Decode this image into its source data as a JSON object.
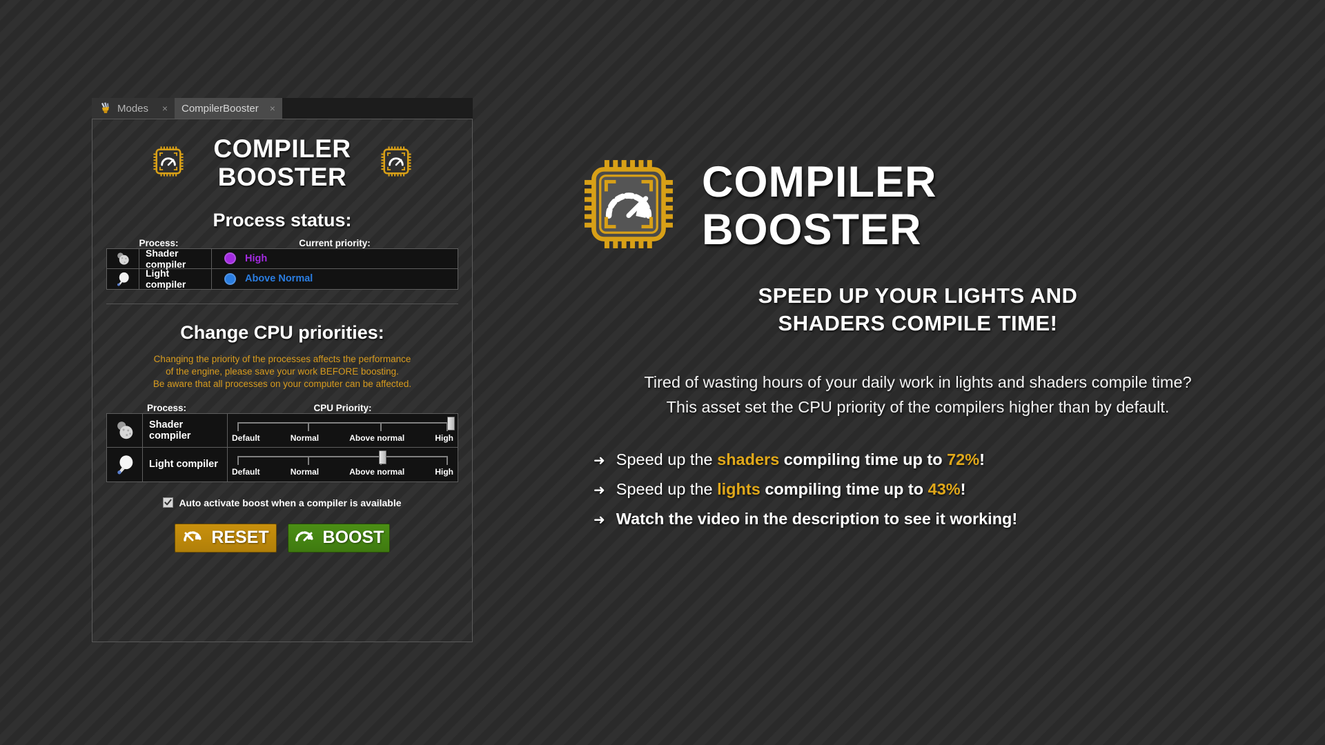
{
  "window": {
    "tabs": [
      {
        "label": "Modes",
        "icon": "modes-brush-icon",
        "active": false,
        "close": "×"
      },
      {
        "label": "CompilerBooster",
        "icon": "",
        "active": true,
        "close": "×"
      }
    ]
  },
  "panel": {
    "title_line1": "COMPILER",
    "title_line2": "BOOSTER",
    "chip_icon": "cpu-chip-gauge-icon",
    "process_status": {
      "title": "Process status:",
      "headers": {
        "process": "Process:",
        "priority": "Current priority:"
      },
      "rows": [
        {
          "icon": "shader-spheres-icon",
          "name": "Shader compiler",
          "priority": "High",
          "color": "#a22ae0"
        },
        {
          "icon": "light-bulb-icon",
          "name": "Light compiler",
          "priority": "Above Normal",
          "color": "#2a7de1"
        }
      ]
    },
    "change_priorities": {
      "title": "Change  CPU priorities:",
      "warning_lines": [
        "Changing the priority of the processes affects the performance",
        "of the engine, please save your work BEFORE boosting.",
        "Be aware that all processes on your computer can be affected."
      ],
      "warning_color": "#d79b1e",
      "headers": {
        "process": "Process:",
        "cpu": "CPU Priority:"
      },
      "slider_labels": [
        "Default",
        "Normal",
        "Above normal",
        "High"
      ],
      "rows": [
        {
          "icon": "shader-spheres-icon",
          "name": "Shader compiler",
          "value": "High",
          "value_index": 3
        },
        {
          "icon": "light-bulb-icon",
          "name": "Light compiler",
          "value": "Above normal",
          "value_index": 2
        }
      ]
    },
    "auto_activate": {
      "label": "Auto activate boost when a compiler is available",
      "checked": true
    },
    "buttons": {
      "reset": {
        "label": "RESET",
        "icon": "gauge-reset-icon",
        "color": "#c9910d"
      },
      "boost": {
        "label": "BOOST",
        "icon": "gauge-boost-icon",
        "color": "#4b8f15"
      }
    }
  },
  "promo": {
    "icon": "cpu-chip-gauge-icon",
    "title_line1": "COMPILER",
    "title_line2": "BOOSTER",
    "tagline_line1": "SPEED UP YOUR LIGHTS AND",
    "tagline_line2": "SHADERS COMPILE TIME!",
    "paragraph_line1": "Tired of wasting hours of your daily work in lights and shaders compile time?",
    "paragraph_line2": "This asset set the CPU priority of the compilers higher than by default.",
    "bullets": [
      {
        "arrow": "➜",
        "prefix": "Speed up the ",
        "highlight": "shaders",
        "middle": " compiling time up to ",
        "highlight2": "72%",
        "suffix": "!"
      },
      {
        "arrow": "➜",
        "prefix": "Speed up the ",
        "highlight": "lights",
        "middle": " compiling time up to ",
        "highlight2": "43%",
        "suffix": "!"
      },
      {
        "arrow": "➜",
        "plain": "Watch the video in the description to see it working!"
      }
    ],
    "highlight_color": "#e0a81a"
  }
}
